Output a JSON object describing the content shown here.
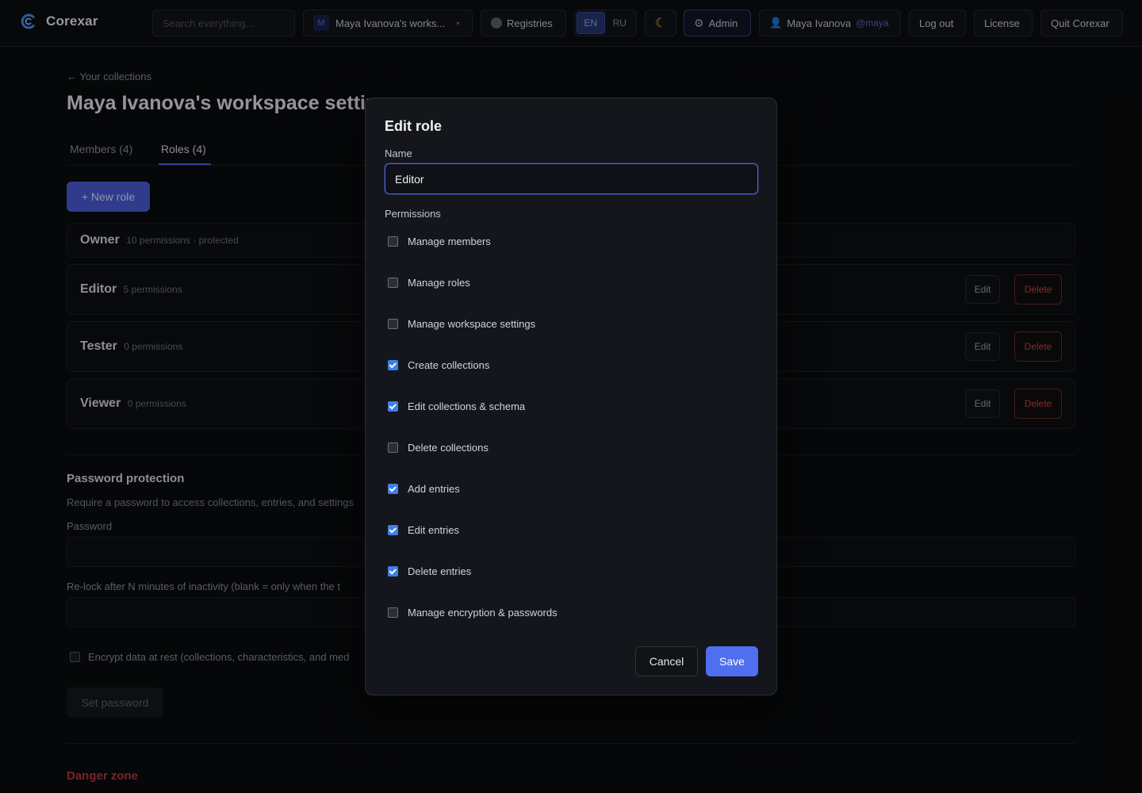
{
  "header": {
    "app_name": "Corexar",
    "search_placeholder": "Search everything...",
    "workspace": {
      "badge": "M",
      "name": "Maya Ivanova's works..."
    },
    "registries_label": "Registries",
    "lang": {
      "en": "EN",
      "ru": "RU",
      "active": "EN"
    },
    "admin_label": "Admin",
    "user": {
      "name": "Maya Ivanova",
      "handle": "@maya"
    },
    "logout_label": "Log out",
    "license_label": "License",
    "quit_label": "Quit Corexar"
  },
  "page": {
    "back_link": "← Your collections",
    "title": "Maya Ivanova's workspace settir",
    "tabs": [
      {
        "label": "Members (4)",
        "active": false
      },
      {
        "label": "Roles (4)",
        "active": true
      }
    ],
    "new_role_label": "+ New role",
    "roles": [
      {
        "name": "Owner",
        "meta": "10 permissions · protected",
        "edit": "",
        "delete": ""
      },
      {
        "name": "Editor",
        "meta": "5 permissions",
        "edit": "Edit",
        "delete": "Delete"
      },
      {
        "name": "Tester",
        "meta": "0 permissions",
        "edit": "Edit",
        "delete": "Delete"
      },
      {
        "name": "Viewer",
        "meta": "0 permissions",
        "edit": "Edit",
        "delete": "Delete"
      }
    ],
    "password": {
      "title": "Password protection",
      "description": "Require a password to access collections, entries, and settings",
      "password_label": "Password",
      "relock_label": "Re-lock after N minutes of inactivity (blank = only when the t",
      "encrypt_label": "Encrypt data at rest (collections, characteristics, and med",
      "set_button": "Set password"
    },
    "danger_title": "Danger zone"
  },
  "modal": {
    "title": "Edit role",
    "name_label": "Name",
    "name_value": "Editor",
    "permissions_label": "Permissions",
    "permissions": [
      {
        "label": "Manage members",
        "checked": false
      },
      {
        "label": "Manage roles",
        "checked": false
      },
      {
        "label": "Manage workspace settings",
        "checked": false
      },
      {
        "label": "Create collections",
        "checked": true
      },
      {
        "label": "Edit collections & schema",
        "checked": true
      },
      {
        "label": "Delete collections",
        "checked": false
      },
      {
        "label": "Add entries",
        "checked": true
      },
      {
        "label": "Edit entries",
        "checked": true
      },
      {
        "label": "Delete entries",
        "checked": true
      },
      {
        "label": "Manage encryption & passwords",
        "checked": false
      }
    ],
    "cancel_label": "Cancel",
    "save_label": "Save"
  },
  "colors": {
    "accent": "#4f6ff0",
    "danger": "#c2474e",
    "checkbox_checked": "#3f7fe6",
    "background": "#0a0b0d",
    "modal_bg": "#14161c"
  },
  "icons": {
    "logo": "corexar-logo-icon",
    "registries": "globe-icon",
    "theme": "moon-icon",
    "admin": "gear-icon",
    "user": "user-icon",
    "workspace_caret": "chevron-down-icon"
  }
}
